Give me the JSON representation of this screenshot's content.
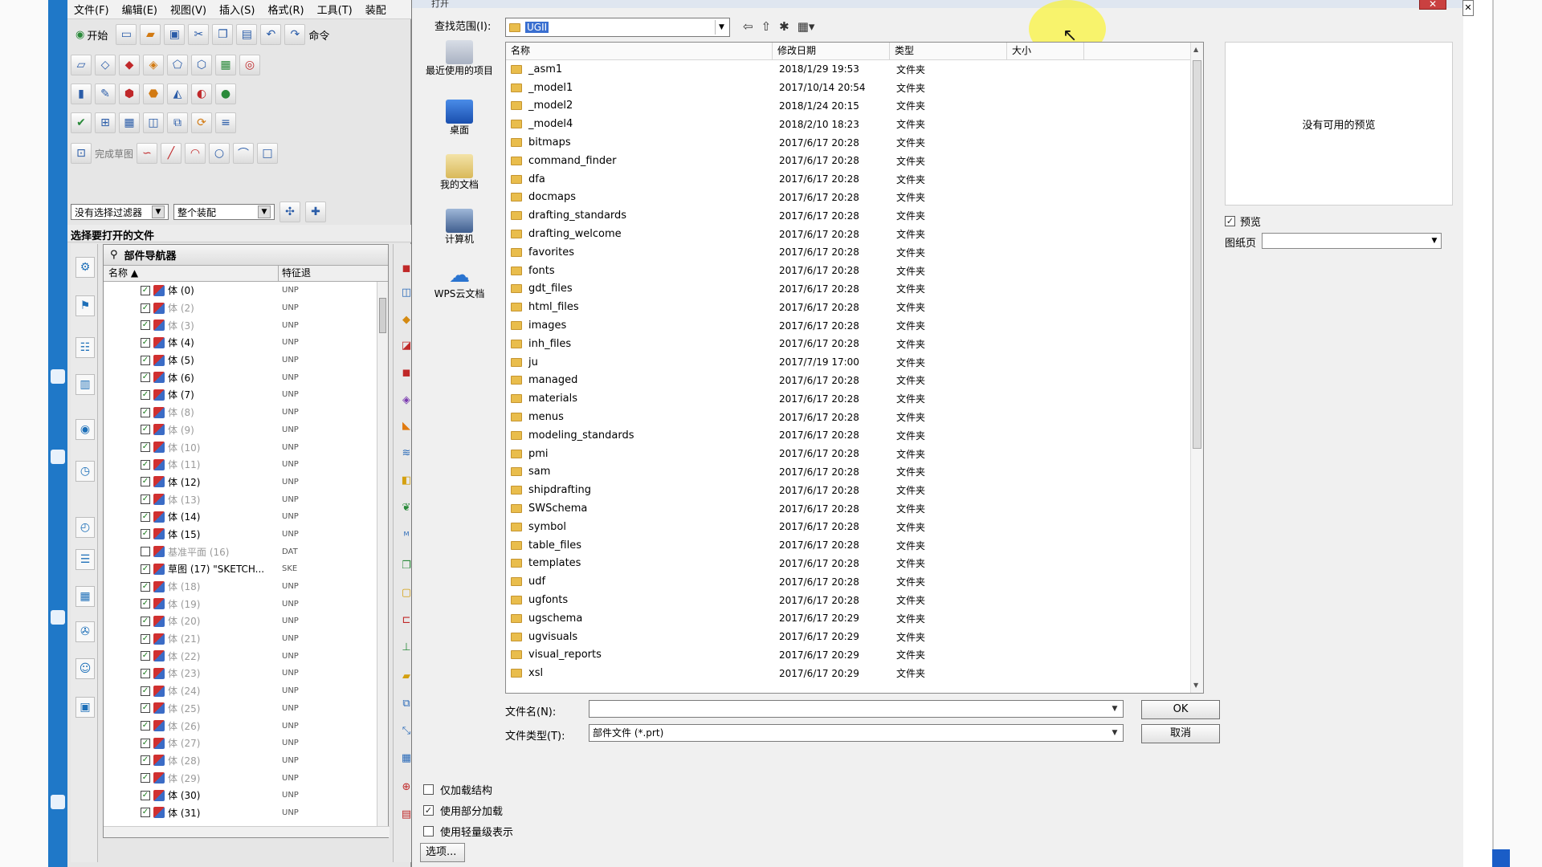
{
  "nx": {
    "menu": [
      "文件(F)",
      "编辑(E)",
      "视图(V)",
      "插入(S)",
      "格式(R)",
      "工具(T)",
      "装配"
    ],
    "start_label": "开始",
    "command_label": "命令",
    "finish_sketch": "完成草图",
    "filter_value": "没有选择过滤器",
    "assembly_value": "整个装配",
    "prompt": "选择要打开的文件",
    "part_nav": {
      "title": "部件导航器",
      "col_name": "名称",
      "col_feature": "特征退",
      "rows": [
        {
          "label": "体 (0)",
          "feat": "UNP",
          "dim": false,
          "checked": true
        },
        {
          "label": "体 (2)",
          "feat": "UNP",
          "dim": true,
          "checked": true
        },
        {
          "label": "体 (3)",
          "feat": "UNP",
          "dim": true,
          "checked": true
        },
        {
          "label": "体 (4)",
          "feat": "UNP",
          "dim": false,
          "checked": true
        },
        {
          "label": "体 (5)",
          "feat": "UNP",
          "dim": false,
          "checked": true
        },
        {
          "label": "体 (6)",
          "feat": "UNP",
          "dim": false,
          "checked": true
        },
        {
          "label": "体 (7)",
          "feat": "UNP",
          "dim": false,
          "checked": true
        },
        {
          "label": "体 (8)",
          "feat": "UNP",
          "dim": true,
          "checked": true
        },
        {
          "label": "体 (9)",
          "feat": "UNP",
          "dim": true,
          "checked": true
        },
        {
          "label": "体 (10)",
          "feat": "UNP",
          "dim": true,
          "checked": true
        },
        {
          "label": "体 (11)",
          "feat": "UNP",
          "dim": true,
          "checked": true
        },
        {
          "label": "体 (12)",
          "feat": "UNP",
          "dim": false,
          "checked": true
        },
        {
          "label": "体 (13)",
          "feat": "UNP",
          "dim": true,
          "checked": true
        },
        {
          "label": "体 (14)",
          "feat": "UNP",
          "dim": false,
          "checked": true
        },
        {
          "label": "体 (15)",
          "feat": "UNP",
          "dim": false,
          "checked": true
        },
        {
          "label": "基准平面 (16)",
          "feat": "DAT",
          "dim": true,
          "checked": false
        },
        {
          "label": "草图 (17) \"SKETCH...",
          "feat": "SKE",
          "dim": false,
          "checked": true
        },
        {
          "label": "体 (18)",
          "feat": "UNP",
          "dim": true,
          "checked": true
        },
        {
          "label": "体 (19)",
          "feat": "UNP",
          "dim": true,
          "checked": true
        },
        {
          "label": "体 (20)",
          "feat": "UNP",
          "dim": true,
          "checked": true
        },
        {
          "label": "体 (21)",
          "feat": "UNP",
          "dim": true,
          "checked": true
        },
        {
          "label": "体 (22)",
          "feat": "UNP",
          "dim": true,
          "checked": true
        },
        {
          "label": "体 (23)",
          "feat": "UNP",
          "dim": true,
          "checked": true
        },
        {
          "label": "体 (24)",
          "feat": "UNP",
          "dim": true,
          "checked": true
        },
        {
          "label": "体 (25)",
          "feat": "UNP",
          "dim": true,
          "checked": true
        },
        {
          "label": "体 (26)",
          "feat": "UNP",
          "dim": true,
          "checked": true
        },
        {
          "label": "体 (27)",
          "feat": "UNP",
          "dim": true,
          "checked": true
        },
        {
          "label": "体 (28)",
          "feat": "UNP",
          "dim": true,
          "checked": true
        },
        {
          "label": "体 (29)",
          "feat": "UNP",
          "dim": true,
          "checked": true
        },
        {
          "label": "体 (30)",
          "feat": "UNP",
          "dim": false,
          "checked": true
        },
        {
          "label": "体 (31)",
          "feat": "UNP",
          "dim": false,
          "checked": true
        }
      ]
    }
  },
  "dialog": {
    "title": "打开",
    "close": "✕",
    "look_in_label": "查找范围(I):",
    "look_in_value": "UGII",
    "places": [
      "最近使用的项目",
      "桌面",
      "我的文档",
      "计算机",
      "WPS云文档"
    ],
    "columns": {
      "name": "名称",
      "date": "修改日期",
      "type": "类型",
      "size": "大小"
    },
    "files": [
      {
        "name": "_asm1",
        "date": "2018/1/29 19:53",
        "type": "文件夹"
      },
      {
        "name": "_model1",
        "date": "2017/10/14 20:54",
        "type": "文件夹"
      },
      {
        "name": "_model2",
        "date": "2018/1/24 20:15",
        "type": "文件夹"
      },
      {
        "name": "_model4",
        "date": "2018/2/10 18:23",
        "type": "文件夹"
      },
      {
        "name": "bitmaps",
        "date": "2017/6/17 20:28",
        "type": "文件夹"
      },
      {
        "name": "command_finder",
        "date": "2017/6/17 20:28",
        "type": "文件夹"
      },
      {
        "name": "dfa",
        "date": "2017/6/17 20:28",
        "type": "文件夹"
      },
      {
        "name": "docmaps",
        "date": "2017/6/17 20:28",
        "type": "文件夹"
      },
      {
        "name": "drafting_standards",
        "date": "2017/6/17 20:28",
        "type": "文件夹"
      },
      {
        "name": "drafting_welcome",
        "date": "2017/6/17 20:28",
        "type": "文件夹"
      },
      {
        "name": "favorites",
        "date": "2017/6/17 20:28",
        "type": "文件夹"
      },
      {
        "name": "fonts",
        "date": "2017/6/17 20:28",
        "type": "文件夹"
      },
      {
        "name": "gdt_files",
        "date": "2017/6/17 20:28",
        "type": "文件夹"
      },
      {
        "name": "html_files",
        "date": "2017/6/17 20:28",
        "type": "文件夹"
      },
      {
        "name": "images",
        "date": "2017/6/17 20:28",
        "type": "文件夹"
      },
      {
        "name": "inh_files",
        "date": "2017/6/17 20:28",
        "type": "文件夹"
      },
      {
        "name": "ju",
        "date": "2017/7/19 17:00",
        "type": "文件夹"
      },
      {
        "name": "managed",
        "date": "2017/6/17 20:28",
        "type": "文件夹"
      },
      {
        "name": "materials",
        "date": "2017/6/17 20:28",
        "type": "文件夹"
      },
      {
        "name": "menus",
        "date": "2017/6/17 20:28",
        "type": "文件夹"
      },
      {
        "name": "modeling_standards",
        "date": "2017/6/17 20:28",
        "type": "文件夹"
      },
      {
        "name": "pmi",
        "date": "2017/6/17 20:28",
        "type": "文件夹"
      },
      {
        "name": "sam",
        "date": "2017/6/17 20:28",
        "type": "文件夹"
      },
      {
        "name": "shipdrafting",
        "date": "2017/6/17 20:28",
        "type": "文件夹"
      },
      {
        "name": "SWSchema",
        "date": "2017/6/17 20:28",
        "type": "文件夹"
      },
      {
        "name": "symbol",
        "date": "2017/6/17 20:28",
        "type": "文件夹"
      },
      {
        "name": "table_files",
        "date": "2017/6/17 20:28",
        "type": "文件夹"
      },
      {
        "name": "templates",
        "date": "2017/6/17 20:28",
        "type": "文件夹"
      },
      {
        "name": "udf",
        "date": "2017/6/17 20:28",
        "type": "文件夹"
      },
      {
        "name": "ugfonts",
        "date": "2017/6/17 20:28",
        "type": "文件夹"
      },
      {
        "name": "ugschema",
        "date": "2017/6/17 20:29",
        "type": "文件夹"
      },
      {
        "name": "ugvisuals",
        "date": "2017/6/17 20:29",
        "type": "文件夹"
      },
      {
        "name": "visual_reports",
        "date": "2017/6/17 20:29",
        "type": "文件夹"
      },
      {
        "name": "xsl",
        "date": "2017/6/17 20:29",
        "type": "文件夹"
      }
    ],
    "preview_text": "没有可用的预览",
    "preview_check": "预览",
    "sheet_label": "图纸页",
    "file_name_label": "文件名(N):",
    "file_name_value": "",
    "file_type_label": "文件类型(T):",
    "file_type_value": "部件文件 (*.prt)",
    "ok": "OK",
    "cancel": "取消",
    "opt_structure": "仅加载结构",
    "opt_partial": "使用部分加载",
    "opt_lightweight": "使用轻量级表示",
    "options_button": "选项..."
  }
}
